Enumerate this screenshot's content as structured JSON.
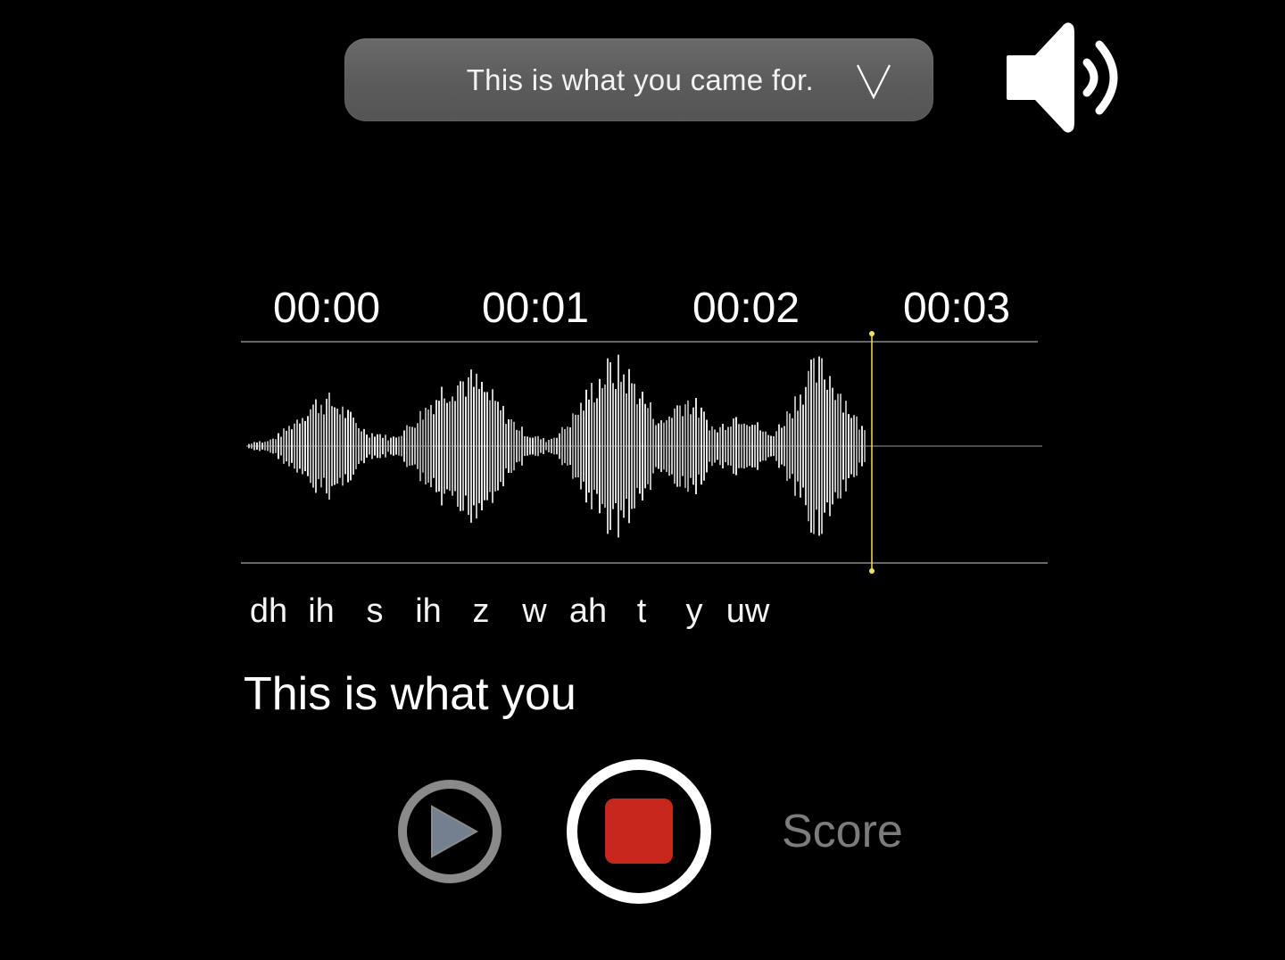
{
  "phrase_selector": {
    "selected_phrase": "This is what you came for."
  },
  "icons": {
    "chevron": "chevron-down-icon",
    "speaker": "speaker-volume-icon",
    "play": "play-icon",
    "stop": "stop-icon"
  },
  "timeline": {
    "labels": [
      "00:00",
      "00:01",
      "00:02",
      "00:03"
    ]
  },
  "phonemes": [
    "dh",
    "ih",
    "s",
    "ih",
    "z",
    "w",
    "ah",
    "t",
    "y",
    "uw"
  ],
  "transcript": "This is what you",
  "controls": {
    "score_label": "Score"
  },
  "colors": {
    "background": "#000000",
    "pill": "#5f5f5f",
    "stop": "#c8281c",
    "playhead": "#f2e25a",
    "play_ring": "#8a8a8a"
  }
}
